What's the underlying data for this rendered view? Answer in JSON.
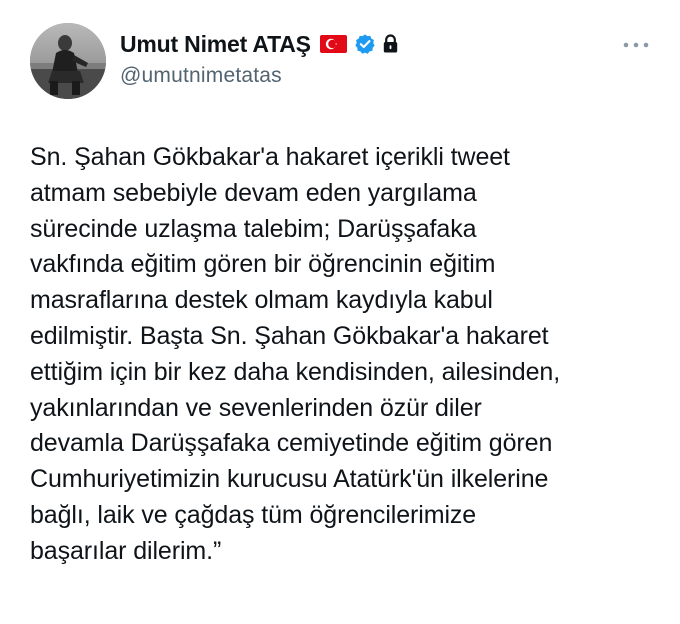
{
  "author": {
    "display_name": "Umut Nimet ATAŞ",
    "handle": "@umutnimetatas",
    "avatar_icon": "profile-photo",
    "flag_icon": "turkey-flag-icon",
    "verified_icon": "verified-badge-icon",
    "lock_icon": "lock-icon"
  },
  "more_icon": "more-horizontal-icon",
  "tweet": {
    "text": "Sn. Şahan Gökbakar'a hakaret içerikli tweet\natmam sebebiyle devam eden yargılama\nsürecinde uzlaşma talebim; Darüşşafaka\nvakfında eğitim gören bir öğrencinin eğitim\nmasraflarına destek olmam kaydıyla kabul\nedilmiştir. Başta Sn. Şahan Gökbakar'a hakaret\nettiğim için bir kez daha kendisinden, ailesinden,\nyakınlarından ve sevenlerinden özür diler\ndevamla Darüşşafaka cemiyetinde eğitim gören\nCumhuriyetimizin kurucusu Atatürk'ün ilkelerine\nbağlı, laik ve çağdaş tüm öğrencilerimize\nbaşarılar dilerim.”"
  },
  "colors": {
    "text_primary": "#0f1419",
    "text_secondary": "#536471",
    "verified_blue": "#1d9bf0",
    "flag_red": "#e30a17"
  }
}
